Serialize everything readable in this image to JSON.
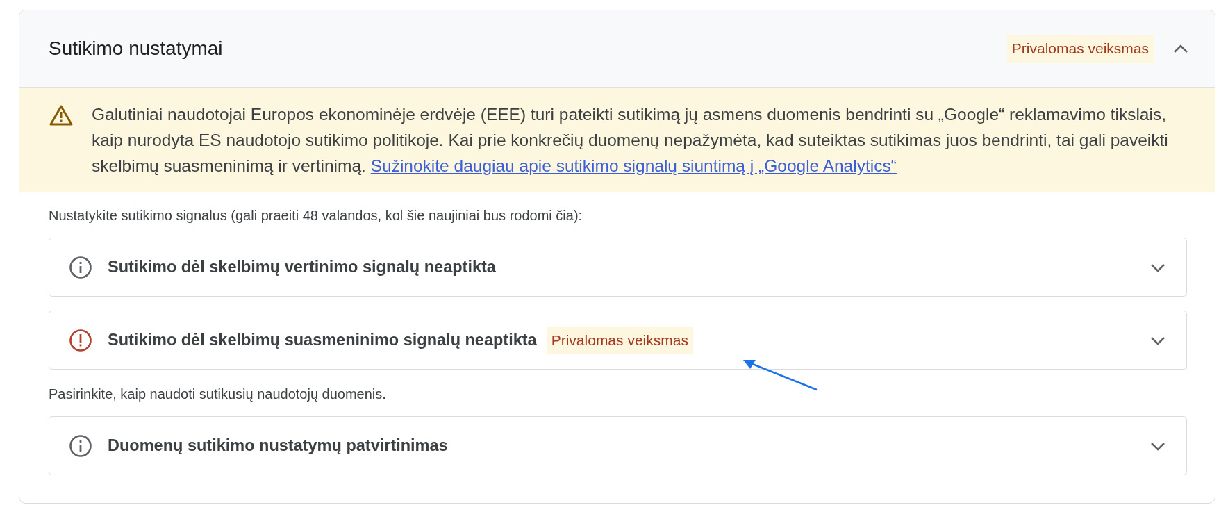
{
  "section": {
    "title": "Sutikimo nustatymai",
    "badge": "Privalomas veiksmas",
    "expanded": true
  },
  "warning": {
    "text": "Galutiniai naudotojai Europos ekonominėje erdvėje (EEE) turi pateikti sutikimą jų asmens duomenis bendrinti su „Google“ reklamavimo tikslais, kaip nurodyta ES naudotojo sutikimo politikoje. Kai prie konkrečių duomenų nepažymėta, kad suteiktas sutikimas juos bendrinti, tai gali paveikti skelbimų suasmeninimą ir vertinimą.",
    "link": "Sužinokite daugiau apie sutikimo signalų siuntimą į „Google Analytics“"
  },
  "blocks": [
    {
      "kind": "text",
      "text": "Nustatykite sutikimo signalus (gali praeiti 48 valandos, kol šie naujiniai bus rodomi čia):"
    },
    {
      "kind": "info",
      "title": "Sutikimo dėl skelbimų vertinimo signalų neaptikta",
      "expanded": false
    },
    {
      "kind": "alert",
      "title": "Sutikimo dėl skelbimų suasmeninimo signalų neaptikta",
      "badge": "Privalomas veiksmas",
      "expanded": false
    },
    {
      "kind": "text",
      "text": "Pasirinkite, kaip naudoti sutikusių naudotojų duomenis."
    },
    {
      "kind": "info",
      "title": "Duomenų sutikimo nustatymų patvirtinimas",
      "expanded": false
    }
  ]
}
